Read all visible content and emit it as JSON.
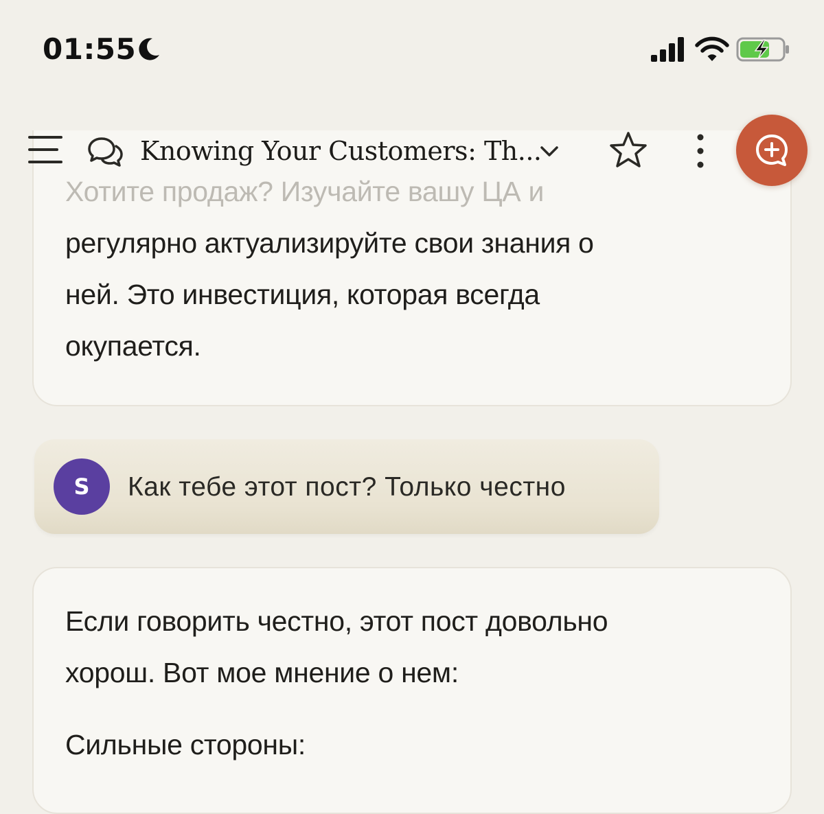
{
  "status_bar": {
    "time": "01:55",
    "icons": [
      "moon-icon",
      "signal-icon",
      "wifi-icon",
      "battery-charging-icon"
    ]
  },
  "header": {
    "title": "Knowing Your Customers: Th...",
    "icons": [
      "menu-icon",
      "chat-icon",
      "chevron-down-icon",
      "star-icon",
      "more-icon",
      "new-chat-icon"
    ],
    "accent_color": "#c7593a"
  },
  "messages": [
    {
      "role": "assistant",
      "faded_line": "Хотите продаж? Изучайте вашу ЦА и",
      "lines": [
        "регулярно актуализируйте свои знания о",
        "ней. Это инвестиция, которая всегда",
        "окупается."
      ]
    },
    {
      "role": "user",
      "avatar_letter": "S",
      "avatar_color": "#5a3fa0",
      "text": "Как тебе этот пост? Только честно"
    },
    {
      "role": "assistant",
      "lines": [
        "Если говорить честно, этот пост довольно",
        "хорош. Вот мое мнение о нем:"
      ],
      "section_heading": "Сильные стороны:"
    }
  ]
}
